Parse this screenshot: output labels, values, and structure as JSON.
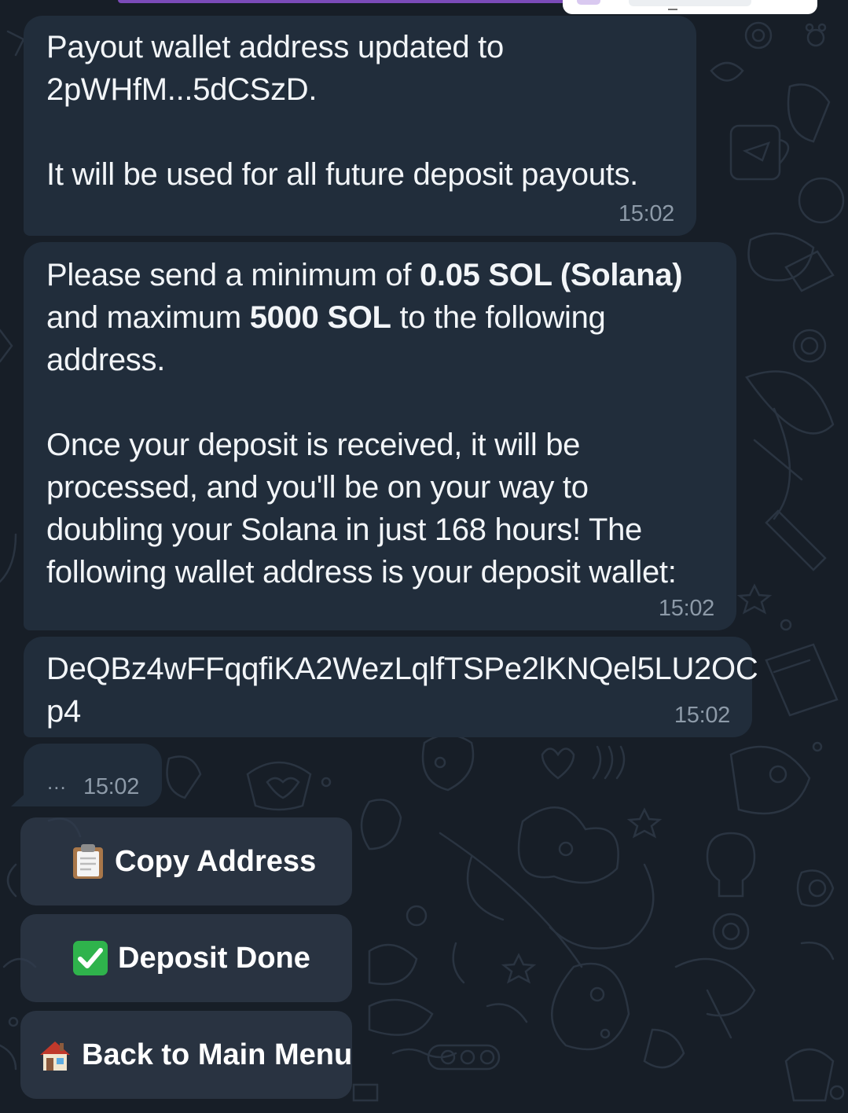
{
  "messages": [
    {
      "lines": [
        "Payout wallet address updated to",
        "2pWHfM...5dCSzD.",
        "",
        "It will be used for all future deposit payouts."
      ],
      "time": "15:02"
    },
    {
      "line1_pre": "Please send a minimum of ",
      "line1_bold": "0.05 SOL (Solana)",
      "line2_pre": "and maximum ",
      "line2_bold": "5000 SOL",
      "line2_post": " to the following",
      "line3": "address.",
      "para2": [
        "Once your deposit is received, it will be",
        "processed, and you'll be on your way to",
        "doubling your Solana in just 168 hours! The",
        "following wallet address is your deposit wallet:"
      ],
      "time": "15:02"
    },
    {
      "lines": [
        "DeQBz4wFFqqfiKA2WezLqlfTSPe2lKNQel5LU2OC",
        "p4"
      ],
      "time": "15:02"
    },
    {
      "dots": "...",
      "time": "15:02"
    }
  ],
  "keyboard": [
    {
      "icon": "clipboard-icon",
      "label": "Copy Address"
    },
    {
      "icon": "check-mark-button-icon",
      "label": "Deposit Done"
    },
    {
      "icon": "house-icon",
      "label": "Back to Main Menu"
    }
  ],
  "colors": {
    "background": "#171e27",
    "bubble": "#212d3b",
    "accent": "#7b4bb8",
    "check_green": "#2fb34c"
  }
}
